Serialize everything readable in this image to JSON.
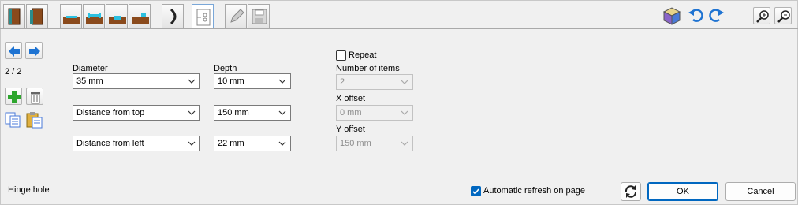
{
  "navigation": {
    "counter": "2 / 2"
  },
  "fields": {
    "diameter": {
      "label": "Diameter",
      "value": "35 mm"
    },
    "depth": {
      "label": "Depth",
      "value": "10 mm"
    },
    "vertical_ref": {
      "value": "Distance from top"
    },
    "vertical_dist": {
      "value": "150 mm"
    },
    "horizontal_ref": {
      "value": "Distance from left"
    },
    "horizontal_dist": {
      "value": "22 mm"
    }
  },
  "repeat": {
    "label": "Repeat",
    "checked": false,
    "items_label": "Number of items",
    "items_value": "2",
    "x_label": "X offset",
    "x_value": "0 mm",
    "y_label": "Y offset",
    "y_value": "150 mm"
  },
  "footer": {
    "status": "Hinge hole",
    "auto_refresh_label": "Automatic refresh on page",
    "auto_refresh_checked": true,
    "ok_label": "OK",
    "cancel_label": "Cancel"
  },
  "colors": {
    "accent": "#0067c0",
    "arrow_blue": "#1e73d2",
    "wood": "#8a4a1c",
    "add_green": "#2ea62e"
  },
  "icons": {
    "toolbar": [
      "book-closed-icon",
      "book-open-icon",
      "groove-shallow-icon",
      "groove-through-icon",
      "groove-step-icon",
      "groove-corner-icon",
      "hinge-curve-icon",
      "hinge-hole-icon",
      "pencil-icon",
      "floppy-disk-icon"
    ],
    "right": [
      "cube-3d-icon",
      "undo-icon",
      "redo-icon",
      "zoom-in-icon",
      "zoom-out-icon"
    ]
  }
}
